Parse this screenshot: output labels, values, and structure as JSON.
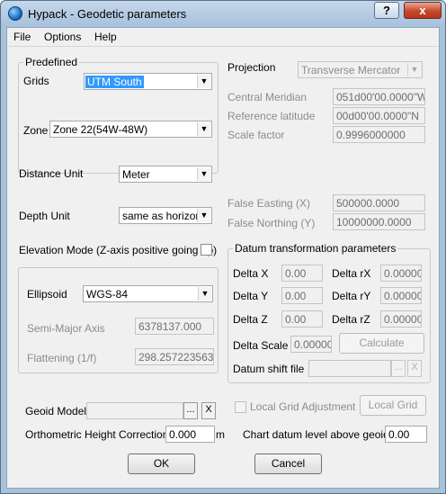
{
  "window": {
    "title": "Hypack - Geodetic parameters",
    "help_glyph": "?",
    "close_glyph": "x"
  },
  "menu": [
    "File",
    "Options",
    "Help"
  ],
  "predefined": {
    "legend": "Predefined",
    "grids_label": "Grids",
    "grids_value": "UTM South",
    "zone_label": "Zone",
    "zone_value": "Zone 22(54W-48W)"
  },
  "distance": {
    "label": "Distance Unit",
    "value": "Meter"
  },
  "depth": {
    "label": "Depth Unit",
    "value": "same as horizonta"
  },
  "elevation_label": "Elevation Mode (Z-axis positive going up)",
  "ellipsoid": {
    "label": "Ellipsoid",
    "value": "WGS-84",
    "semimajor_label": "Semi-Major Axis",
    "semimajor_value": "6378137.000",
    "flattening_label": "Flattening (1/f)",
    "flattening_value": "298.257223563"
  },
  "projection": {
    "label": "Projection",
    "value": "Transverse Mercator",
    "central_meridian_label": "Central Meridian",
    "central_meridian_value": "051d00'00.0000\"W",
    "ref_lat_label": "Reference latitude",
    "ref_lat_value": "00d00'00.0000\"N",
    "scale_label": "Scale factor",
    "scale_value": "0.9996000000",
    "false_easting_label": "False Easting (X)",
    "false_easting_value": "500000.0000",
    "false_northing_label": "False Northing (Y)",
    "false_northing_value": "10000000.0000"
  },
  "datum": {
    "legend": "Datum transformation parameters",
    "dx_label": "Delta X",
    "dx": "0.00",
    "dy_label": "Delta Y",
    "dy": "0.00",
    "dz_label": "Delta Z",
    "dz": "0.00",
    "rx_label": "Delta rX",
    "rx": "0.00000",
    "ry_label": "Delta rY",
    "ry": "0.00000",
    "rz_label": "Delta rZ",
    "rz": "0.00000",
    "scale_label": "Delta Scale",
    "scale": "0.00000",
    "calculate_label": "Calculate",
    "shift_label": "Datum shift file"
  },
  "geoid": {
    "label": "Geoid Model",
    "browse": "...",
    "clear": "X"
  },
  "local_grid": {
    "checkbox_label": "Local Grid Adjustment",
    "button_label": "Local Grid"
  },
  "ortho": {
    "label": "Orthometric Height Correction",
    "value": "0.000",
    "unit": "m"
  },
  "chart_datum": {
    "label": "Chart datum level above geoid",
    "value": "0.00"
  },
  "buttons": {
    "ok": "OK",
    "cancel": "Cancel"
  },
  "icons": {
    "dropdown": "▼",
    "browse": "...",
    "clear": "X"
  }
}
